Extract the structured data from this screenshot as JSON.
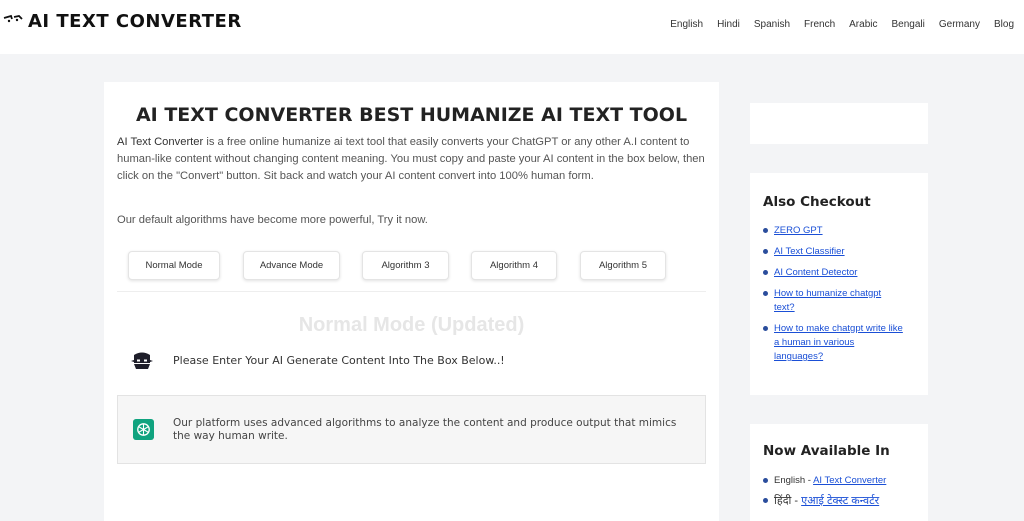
{
  "header": {
    "logo_text": "AI TEXT CONVERTER",
    "nav": [
      "English",
      "Hindi",
      "Spanish",
      "French",
      "Arabic",
      "Bengali",
      "Germany",
      "Blog"
    ]
  },
  "main": {
    "title": "AI TEXT CONVERTER BEST HUMANIZE AI TEXT TOOL",
    "intro_brand": "AI Text Converter",
    "intro_rest": " is a free online humanize ai text tool that easily converts your ChatGPT or any other A.I content to human-like content without changing content meaning. You must copy and paste your AI content in the box below, then click on the \"Convert\" button. Sit back and watch your AI content convert into 100% human form.",
    "algo_note": "Our default algorithms have become more powerful, Try it now.",
    "modes": [
      "Normal Mode",
      "Advance Mode",
      "Algorithm 3",
      "Algorithm 4",
      "Algorithm 5"
    ],
    "mode_heading": "Normal Mode (Updated)",
    "bot_message": "Please Enter Your AI Generate Content Into The Box Below..!",
    "gpt_message": "Our platform uses advanced algorithms to analyze the content and produce output that mimics the way human write."
  },
  "sidebar": {
    "also_checkout": {
      "title": "Also Checkout",
      "links": [
        "ZERO GPT",
        "AI Text Classifier",
        "AI Content Detector",
        "How to humanize chatgpt text?",
        "How to make chatgpt write like a human in various languages?"
      ]
    },
    "now_available": {
      "title": "Now Available In",
      "items": [
        {
          "prefix": "English - ",
          "link": "AI Text Converter"
        },
        {
          "prefix": "हिंदी - ",
          "link": "एआई टेक्स्ट कन्वर्टर"
        }
      ]
    }
  },
  "colors": {
    "link": "#1a4fd6",
    "bullet": "#2a4d9c",
    "gpt_green": "#10a37f",
    "page_bg": "#f3f4f6"
  }
}
